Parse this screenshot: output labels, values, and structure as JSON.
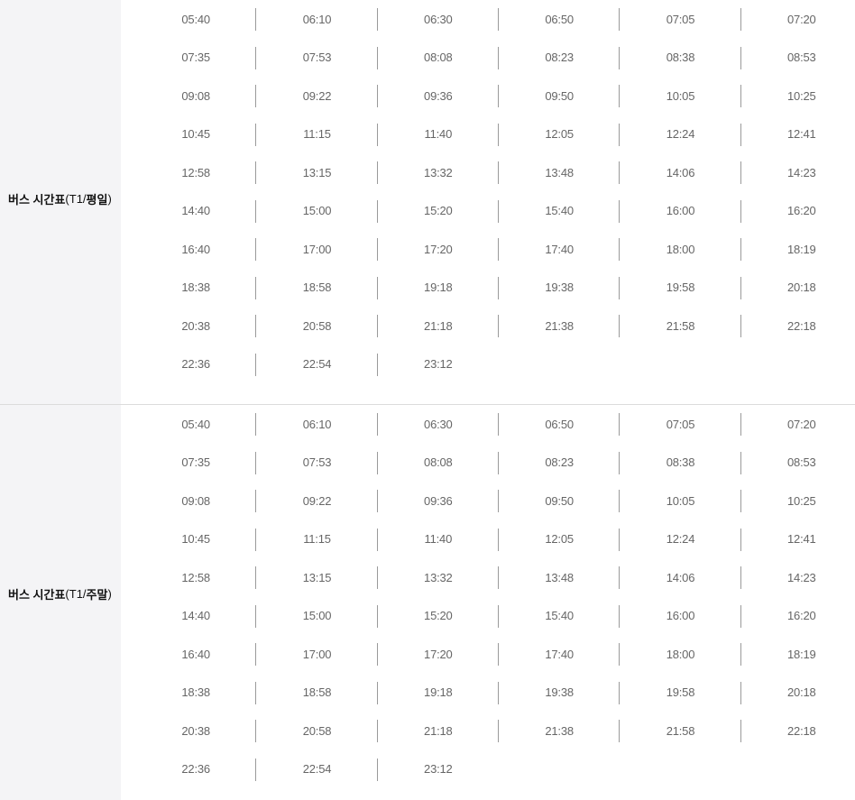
{
  "sections": [
    {
      "id": "weekday",
      "label_main": "버스 시간표",
      "label_code": "(T1/",
      "label_day": "평일",
      "label_close": ")",
      "rows": [
        [
          "05:40",
          "06:10",
          "06:30",
          "06:50",
          "07:05",
          "07:20"
        ],
        [
          "07:35",
          "07:53",
          "08:08",
          "08:23",
          "08:38",
          "08:53"
        ],
        [
          "09:08",
          "09:22",
          "09:36",
          "09:50",
          "10:05",
          "10:25"
        ],
        [
          "10:45",
          "11:15",
          "11:40",
          "12:05",
          "12:24",
          "12:41"
        ],
        [
          "12:58",
          "13:15",
          "13:32",
          "13:48",
          "14:06",
          "14:23"
        ],
        [
          "14:40",
          "15:00",
          "15:20",
          "15:40",
          "16:00",
          "16:20"
        ],
        [
          "16:40",
          "17:00",
          "17:20",
          "17:40",
          "18:00",
          "18:19"
        ],
        [
          "18:38",
          "18:58",
          "19:18",
          "19:38",
          "19:58",
          "20:18"
        ],
        [
          "20:38",
          "20:58",
          "21:18",
          "21:38",
          "21:58",
          "22:18"
        ],
        [
          "22:36",
          "22:54",
          "23:12",
          "",
          "",
          ""
        ]
      ]
    },
    {
      "id": "weekend",
      "label_main": "버스 시간표",
      "label_code": "(T1/",
      "label_day": "주말",
      "label_close": ")",
      "rows": [
        [
          "05:40",
          "06:10",
          "06:30",
          "06:50",
          "07:05",
          "07:20"
        ],
        [
          "07:35",
          "07:53",
          "08:08",
          "08:23",
          "08:38",
          "08:53"
        ],
        [
          "09:08",
          "09:22",
          "09:36",
          "09:50",
          "10:05",
          "10:25"
        ],
        [
          "10:45",
          "11:15",
          "11:40",
          "12:05",
          "12:24",
          "12:41"
        ],
        [
          "12:58",
          "13:15",
          "13:32",
          "13:48",
          "14:06",
          "14:23"
        ],
        [
          "14:40",
          "15:00",
          "15:20",
          "15:40",
          "16:00",
          "16:20"
        ],
        [
          "16:40",
          "17:00",
          "17:20",
          "17:40",
          "18:00",
          "18:19"
        ],
        [
          "18:38",
          "18:58",
          "19:18",
          "19:38",
          "19:58",
          "20:18"
        ],
        [
          "20:38",
          "20:58",
          "21:18",
          "21:38",
          "21:58",
          "22:18"
        ],
        [
          "22:36",
          "22:54",
          "23:12",
          "",
          "",
          ""
        ]
      ]
    }
  ]
}
